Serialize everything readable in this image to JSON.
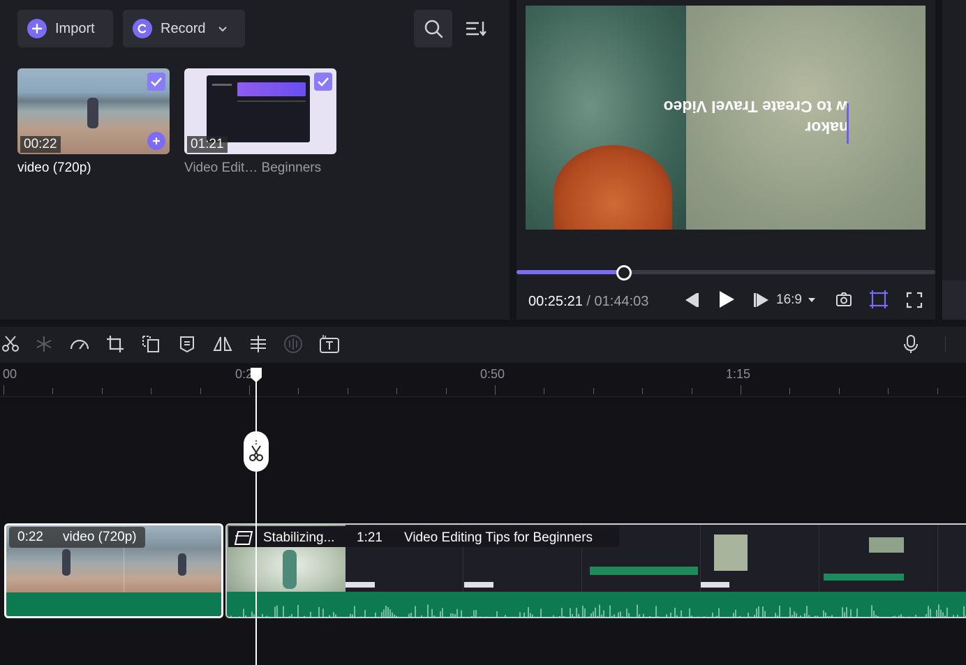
{
  "media": {
    "import_label": "Import",
    "record_label": "Record",
    "items": [
      {
        "duration": "00:22",
        "name": "video (720p)"
      },
      {
        "duration": "01:21",
        "name": "Video Edit… Beginners"
      }
    ]
  },
  "preview": {
    "overlay_text_line1": "w to Create Travel Video",
    "overlay_text_line2": "nakor",
    "current_time": "00:25:21",
    "total_time": "/ 01:44:03",
    "aspect_ratio": "16:9",
    "progress_fraction": 0.256
  },
  "toolbar": {
    "tools": [
      "scissors-icon",
      "freeze-icon",
      "speed-icon",
      "crop-icon",
      "duplicate-icon",
      "subtitle-icon",
      "mirror-icon",
      "align-icon",
      "audio-detect-icon",
      "text-to-speech-icon"
    ]
  },
  "timeline": {
    "ruler_labels": [
      "00",
      "0:2",
      "0:50",
      "1:15"
    ],
    "clip1": {
      "duration": "0:22",
      "name": "video (720p)"
    },
    "clip2": {
      "status": "Stabilizing...",
      "duration": "1:21",
      "name": "Video Editing Tips for Beginners"
    }
  },
  "colors": {
    "accent": "#7b6cf6",
    "audio_track": "#0e7a52",
    "background": "#131318",
    "panel": "#1d1d24"
  }
}
